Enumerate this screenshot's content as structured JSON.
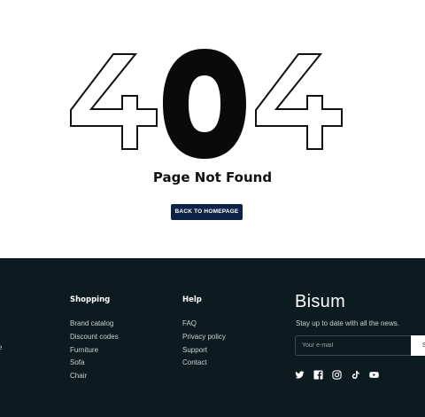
{
  "error": {
    "code_digits": [
      "4",
      "0",
      "4"
    ],
    "title": "Page Not Found",
    "back_button": "BACK TO HOMEPAGE"
  },
  "footer": {
    "cut_link": "e",
    "shopping": {
      "heading": "Shopping",
      "links": [
        "Brand catalog",
        "Discount codes",
        "Furniture",
        "Sofa",
        "Chair"
      ]
    },
    "help": {
      "heading": "Help",
      "links": [
        "FAQ",
        "Privacy policy",
        "Support",
        "Contact"
      ]
    },
    "brand": "Bisum",
    "tagline": "Stay up to date with all the news.",
    "email_placeholder": "Your e-mail",
    "subscribe_label": "S",
    "social_icons": [
      "twitter-icon",
      "facebook-icon",
      "instagram-icon",
      "tiktok-icon",
      "youtube-icon"
    ]
  },
  "colors": {
    "footer_bg": "#0c1b1f",
    "button_bg": "#0c2347"
  }
}
